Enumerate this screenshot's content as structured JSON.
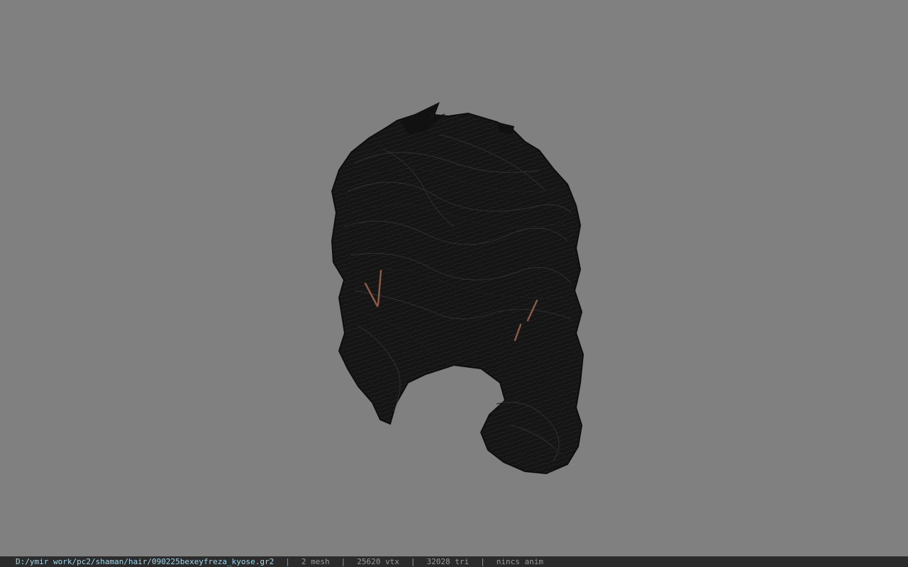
{
  "viewport": {
    "background_color": "#808080",
    "model_name": "hair-model",
    "hair_color": "#141414",
    "hairpin_color": "#8a5a46"
  },
  "status_bar": {
    "file_path": "D:/ymir work/pc2/shaman/hair/090225bexeyfreza_kyose.gr2",
    "separator": "|",
    "mesh_count": "2 mesh",
    "vertex_count": "25620 vtx",
    "triangle_count": "32028 tri",
    "anim_status": "nincs anim"
  }
}
